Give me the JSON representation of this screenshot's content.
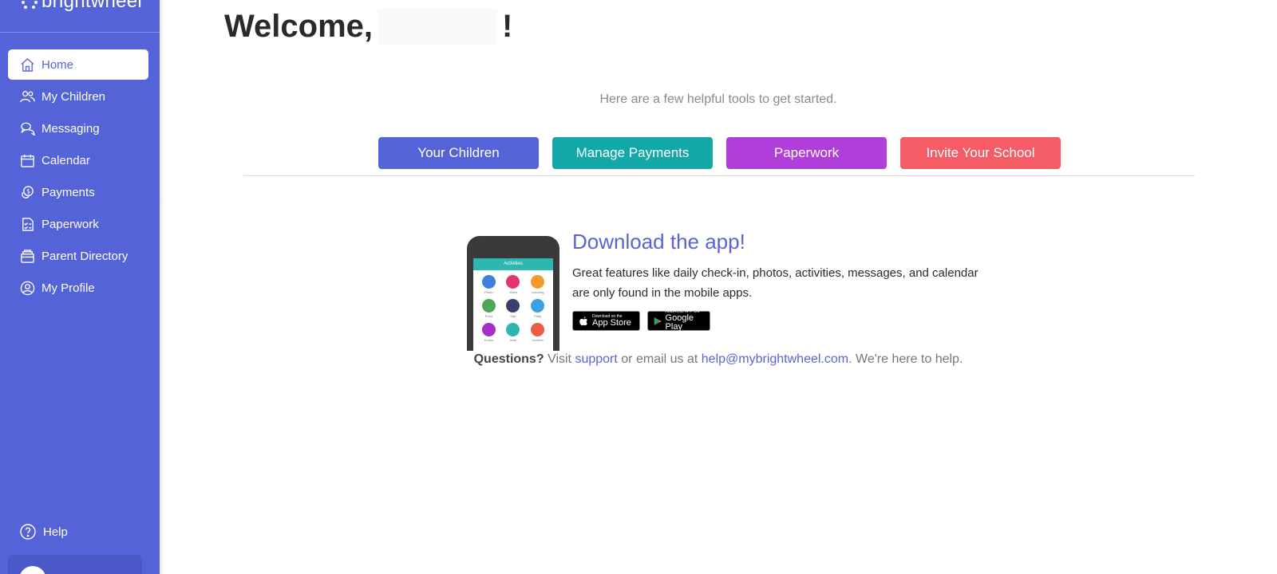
{
  "brand": {
    "name": "brightwheel",
    "sidebar_color": "#5463d8"
  },
  "sidebar": {
    "items": [
      {
        "label": "Home",
        "icon": "home-icon",
        "active": true
      },
      {
        "label": "My Children",
        "icon": "people-icon",
        "active": false
      },
      {
        "label": "Messaging",
        "icon": "chat-icon",
        "active": false
      },
      {
        "label": "Calendar",
        "icon": "calendar-icon",
        "active": false
      },
      {
        "label": "Payments",
        "icon": "dollar-coins-icon",
        "active": false
      },
      {
        "label": "Paperwork",
        "icon": "document-check-icon",
        "active": false
      },
      {
        "label": "Parent Directory",
        "icon": "folder-icon",
        "active": false
      },
      {
        "label": "My Profile",
        "icon": "user-circle-icon",
        "active": false
      }
    ],
    "help_label": "Help"
  },
  "main": {
    "welcome_prefix": "Welcome,",
    "welcome_suffix": "!",
    "subtitle": "Here are a few helpful tools to get started.",
    "tools": [
      {
        "label": "Your Children",
        "color": "#5463d8"
      },
      {
        "label": "Manage Payments",
        "color": "#13a7a7"
      },
      {
        "label": "Paperwork",
        "color": "#b03ed8"
      },
      {
        "label": "Invite Your School",
        "color": "#f65c65"
      }
    ],
    "app_promo": {
      "title": "Download the app!",
      "description": "Great features like daily check-in, photos, activities, messages, and calendar are only found in the mobile apps.",
      "phone_header": "Activities",
      "phone_apps": [
        {
          "label": "Photo",
          "color": "#3f7fe0"
        },
        {
          "label": "Video",
          "color": "#e0356d"
        },
        {
          "label": "Learning",
          "color": "#f39a2a"
        },
        {
          "label": "Food",
          "color": "#4fa65a"
        },
        {
          "label": "Nap",
          "color": "#3a3f6e"
        },
        {
          "label": "Potty",
          "color": "#3aa0e0"
        },
        {
          "label": "Kudos",
          "color": "#a52fc7"
        },
        {
          "label": "Note",
          "color": "#2cb8b0"
        },
        {
          "label": "Incident",
          "color": "#ef5a45"
        }
      ],
      "app_store": {
        "small": "Download on the",
        "big": "App Store"
      },
      "google_play": {
        "small": "ANDROID APP ON",
        "big": "Google Play"
      }
    },
    "footer": {
      "questions_label": "Questions?",
      "visit_text": "Visit",
      "support_link": "support",
      "email_text": "or email us at",
      "email_link": "help@mybrightwheel.com",
      "closing_text": ". We're here to help."
    }
  }
}
